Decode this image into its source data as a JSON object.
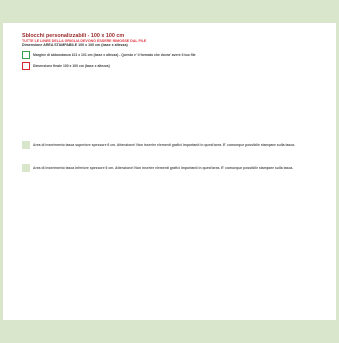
{
  "header": {
    "title": "Sblocchi personalizzabili - 100 x 100 cm",
    "warning": "TUTTE LE LINEE DELLA GRIGLIA DEVONO ESSERE RIMOSSE DAL FILE",
    "printable_area": "Dimensione AREA STAMPABILE 100 x 100 cm (base x altezza)"
  },
  "legend": [
    {
      "color": "#3aa14a",
      "text": "Margine di abbondanza 101 x 101 cm (base x altezza) - Questo e' il formato che dovra' avere il tuo file"
    },
    {
      "color": "#d9262e",
      "text": "Dimensione finale 100 x 100 cm (base x altezza)"
    }
  ],
  "notes": {
    "top": "Area di inserimento tasca superiore spessore 6 cm. Attenzione! Non inserire elementi grafici importanti in quest'area. E' comunque possibile stampare sulla tasca.",
    "bottom": "Area di inserimento tasca inferiore spessore 6 cm. Attenzione! Non inserire elementi grafici importanti in quest'area. E' comunque possibile stampare sulla tasca."
  },
  "colors": {
    "band": "#d9e6cc",
    "title": "#9b2a2a",
    "warning": "#e0343d"
  }
}
